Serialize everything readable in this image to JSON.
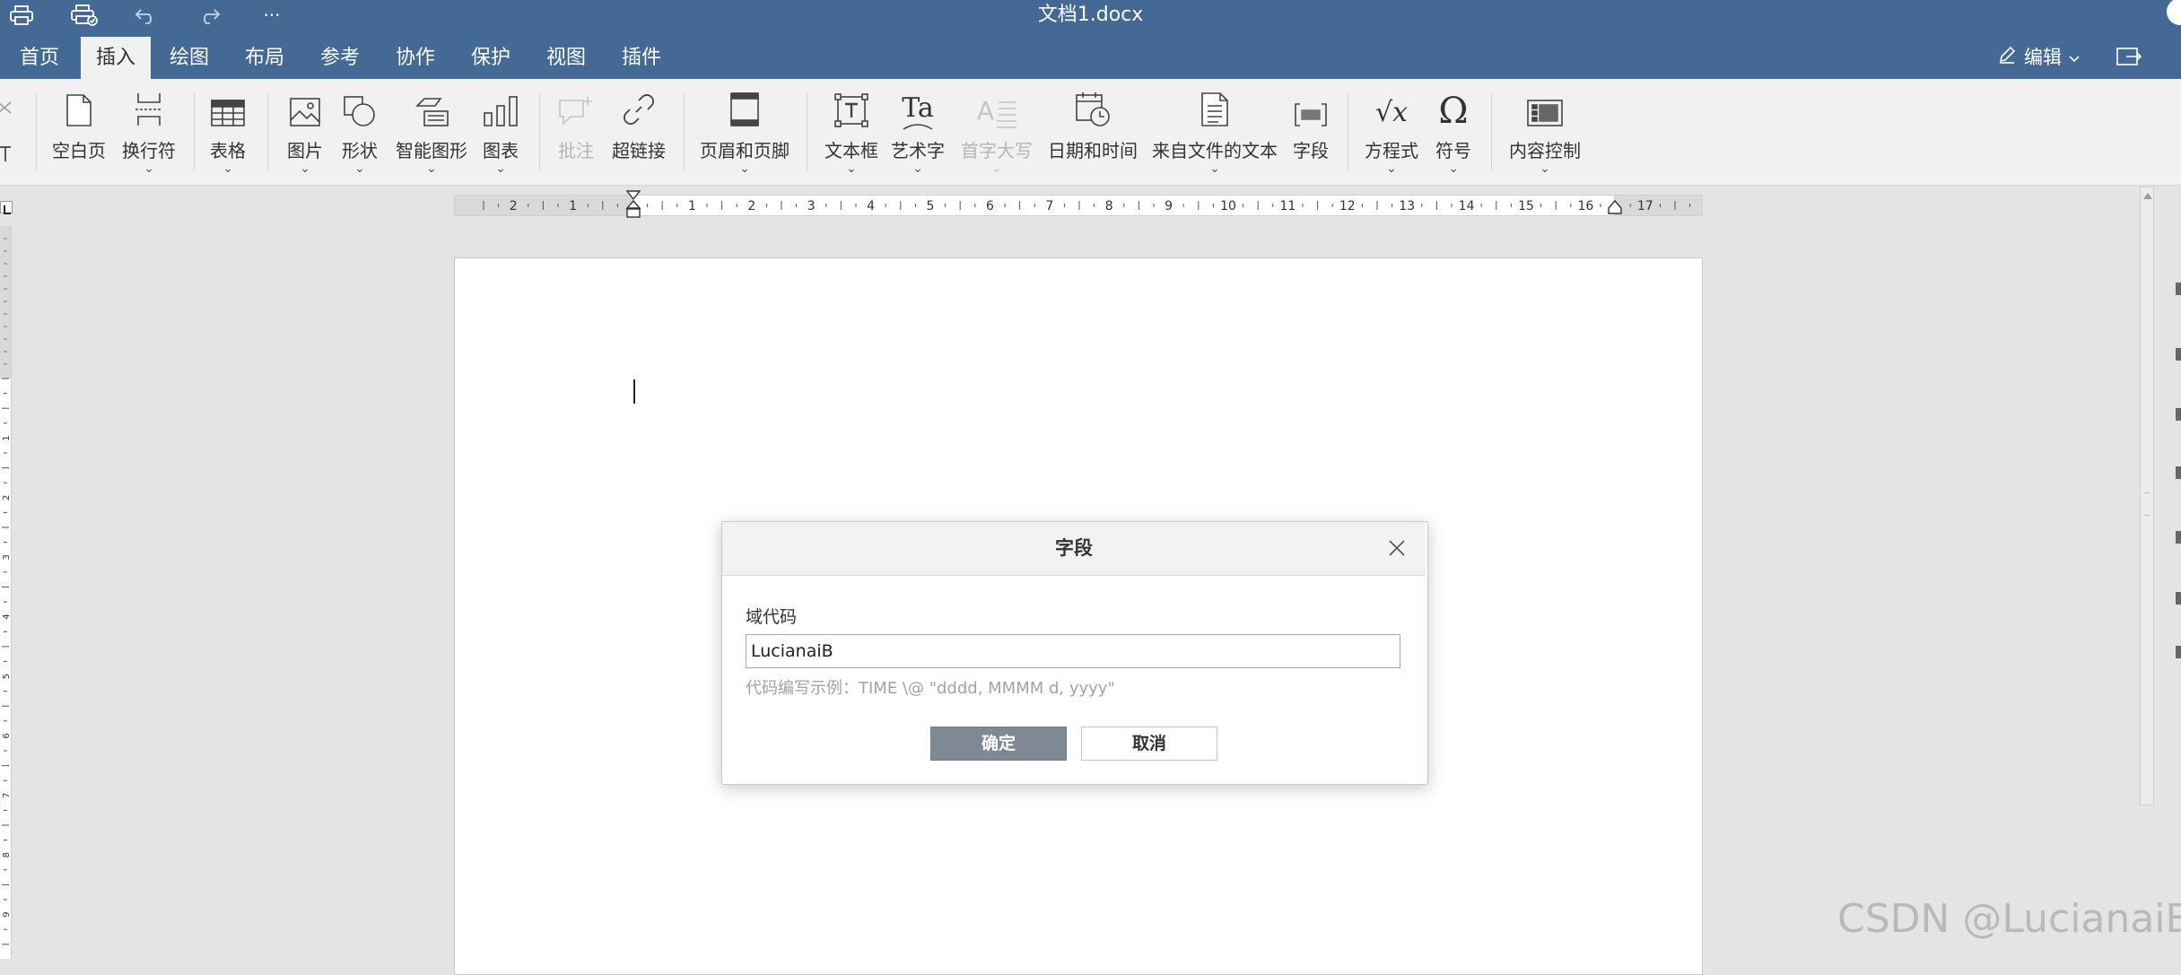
{
  "titlebar": {
    "document_title": "文档1.docx",
    "quick_access": [
      {
        "name": "print-icon"
      },
      {
        "name": "quick-print-icon"
      },
      {
        "name": "undo-icon"
      },
      {
        "name": "redo-icon"
      },
      {
        "name": "more-icon",
        "glyph": "···"
      }
    ]
  },
  "menu": {
    "tabs": [
      "首页",
      "插入",
      "绘图",
      "布局",
      "参考",
      "协作",
      "保护",
      "视图",
      "插件"
    ],
    "active_tab": "插入",
    "edit_label": "编辑"
  },
  "ribbon": {
    "buttons": [
      {
        "label": "空白页",
        "icon": "blank-page-icon",
        "dropdown": false,
        "enabled": true
      },
      {
        "label": "换行符",
        "icon": "page-break-icon",
        "dropdown": true,
        "enabled": true
      },
      {
        "label": "表格",
        "icon": "table-icon",
        "dropdown": true,
        "enabled": true
      },
      {
        "label": "图片",
        "icon": "image-icon",
        "dropdown": true,
        "enabled": true
      },
      {
        "label": "形状",
        "icon": "shape-icon",
        "dropdown": true,
        "enabled": true
      },
      {
        "label": "智能图形",
        "icon": "smartart-icon",
        "dropdown": true,
        "enabled": true
      },
      {
        "label": "图表",
        "icon": "chart-icon",
        "dropdown": true,
        "enabled": true
      },
      {
        "label": "批注",
        "icon": "comment-icon",
        "dropdown": false,
        "enabled": false
      },
      {
        "label": "超链接",
        "icon": "hyperlink-icon",
        "dropdown": false,
        "enabled": true
      },
      {
        "label": "页眉和页脚",
        "icon": "header-footer-icon",
        "dropdown": true,
        "enabled": true
      },
      {
        "label": "文本框",
        "icon": "textbox-icon",
        "dropdown": true,
        "enabled": true
      },
      {
        "label": "艺术字",
        "icon": "wordart-icon",
        "dropdown": true,
        "enabled": true,
        "glyph": "Ta"
      },
      {
        "label": "首字大写",
        "icon": "drop-cap-icon",
        "dropdown": true,
        "enabled": false,
        "glyph": "A"
      },
      {
        "label": "日期和时间",
        "icon": "date-time-icon",
        "dropdown": false,
        "enabled": true
      },
      {
        "label": "来自文件的文本",
        "icon": "text-from-file-icon",
        "dropdown": true,
        "enabled": true
      },
      {
        "label": "字段",
        "icon": "field-icon",
        "dropdown": false,
        "enabled": true
      },
      {
        "label": "方程式",
        "icon": "equation-icon",
        "dropdown": true,
        "enabled": true,
        "glyph": "√x"
      },
      {
        "label": "符号",
        "icon": "symbol-icon",
        "dropdown": true,
        "enabled": true,
        "glyph": "Ω"
      },
      {
        "label": "内容控制",
        "icon": "content-control-icon",
        "dropdown": true,
        "enabled": true
      }
    ]
  },
  "ruler": {
    "left_numbers": [
      "2",
      "1"
    ],
    "right_numbers": [
      "1",
      "2",
      "3",
      "4",
      "5",
      "6",
      "7",
      "8",
      "9",
      "10",
      "11",
      "12",
      "13",
      "14",
      "15",
      "16",
      "17"
    ],
    "vertical_numbers": [
      "1",
      "2",
      "3",
      "4",
      "5",
      "6",
      "7",
      "8",
      "9"
    ]
  },
  "dialog": {
    "title": "字段",
    "label": "域代码",
    "input_value": "LucianaiB",
    "hint": "代码编写示例：TIME \\@ \"dddd, MMMM d, yyyy\"",
    "ok_label": "确定",
    "cancel_label": "取消"
  },
  "watermark": "CSDN @LucianaiB"
}
